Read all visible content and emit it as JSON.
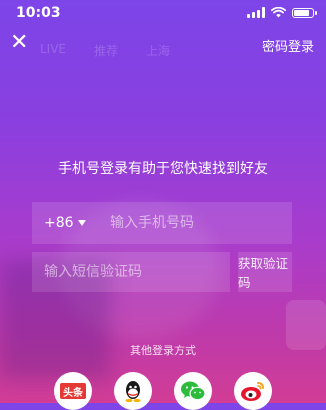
{
  "status_bar": {
    "time": "10:03"
  },
  "topbar": {
    "ghost_tabs": [
      "LIVE",
      "推荐",
      "上海"
    ],
    "password_login": "密码登录"
  },
  "headline": "手机号登录有助于您快速找到好友",
  "phone": {
    "country_code": "+86",
    "placeholder": "输入手机号码"
  },
  "code": {
    "placeholder": "输入短信验证码",
    "get_code": "获取验证码"
  },
  "other_login": {
    "title": "其他登录方式",
    "providers": [
      {
        "name": "toutiao",
        "label": "头条",
        "color": "#e53935"
      },
      {
        "name": "qq",
        "color": "#1a1a1a"
      },
      {
        "name": "wechat",
        "color": "#2dbb3c"
      },
      {
        "name": "weibo",
        "color": "#e6162d"
      }
    ]
  }
}
